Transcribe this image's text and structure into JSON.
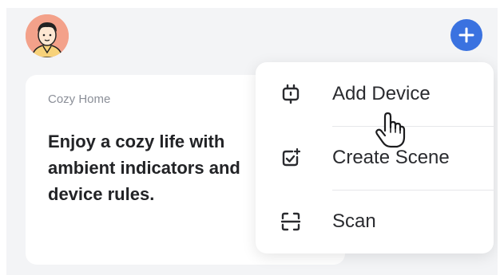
{
  "header": {
    "avatar_icon": "user-avatar-icon",
    "add_icon": "plus-circle-icon",
    "accent_color": "#3a72e0"
  },
  "home": {
    "name": "Cozy Home",
    "description": "Enjoy a cozy life with ambient indicators and device rules."
  },
  "menu": {
    "items": [
      {
        "label": "Add Device",
        "icon": "device-plug-icon"
      },
      {
        "label": "Create Scene",
        "icon": "scene-check-icon"
      },
      {
        "label": "Scan",
        "icon": "scan-frame-icon"
      }
    ]
  },
  "cursor": {
    "icon": "hand-pointer-icon"
  }
}
